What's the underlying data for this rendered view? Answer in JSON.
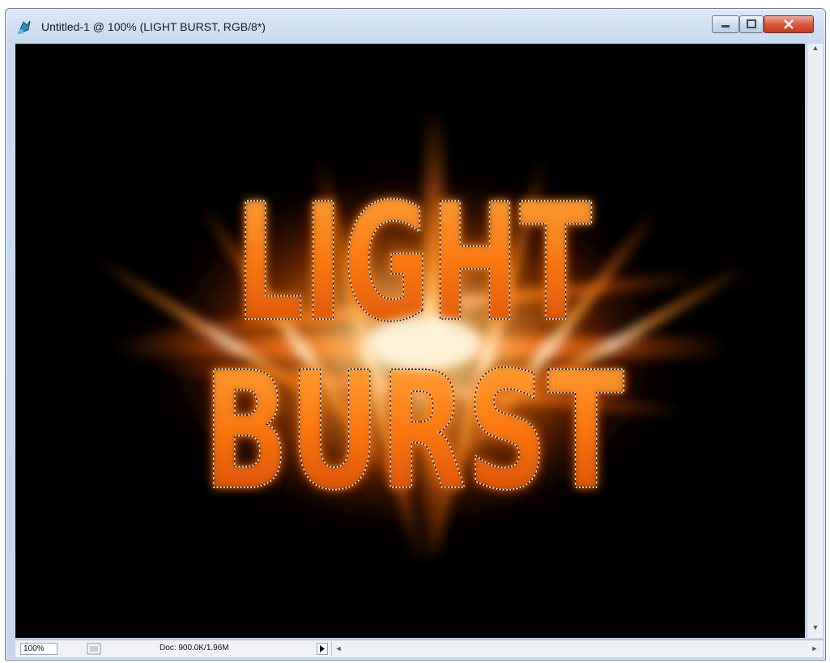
{
  "window": {
    "title": "Untitled-1 @ 100% (LIGHT BURST, RGB/8*)"
  },
  "artwork": {
    "line1": "LIGHT",
    "line2": "BURST",
    "glow_color": "#ff6a00",
    "core_color": "#fff4d8",
    "background_color": "#000000",
    "selection": "marching-ants"
  },
  "statusbar": {
    "zoom": "100%",
    "doc_info": "Doc: 900.0K/1.96M"
  },
  "colors": {
    "window_frame": "#c8daef",
    "close_button": "#d9593e"
  }
}
